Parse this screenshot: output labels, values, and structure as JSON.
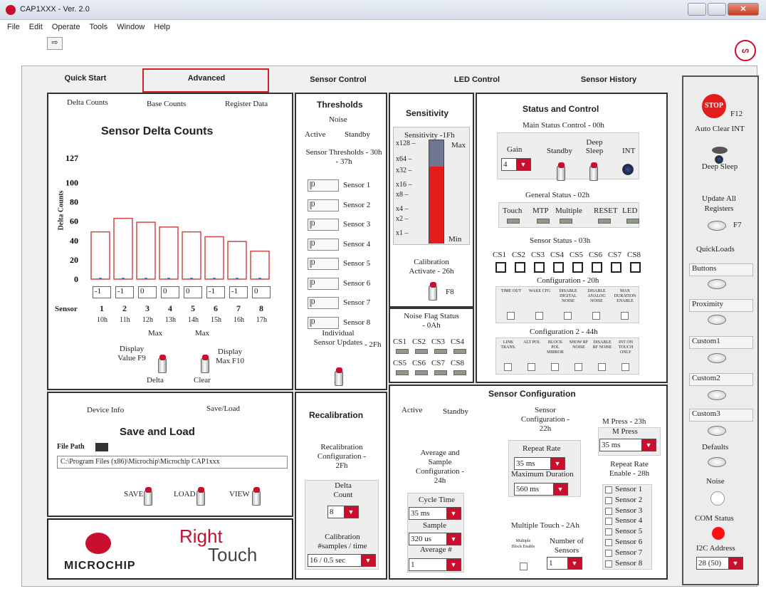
{
  "window": {
    "title": "CAP1XXX - Ver. 2.0"
  },
  "menu": [
    "File",
    "Edit",
    "Operate",
    "Tools",
    "Window",
    "Help"
  ],
  "tabs": [
    "Quick Start",
    "Advanced",
    "Sensor Control",
    "LED Control",
    "Sensor History"
  ],
  "delta": {
    "subtabs": [
      "Delta Counts",
      "Base Counts",
      "Register Data"
    ],
    "title": "Sensor Delta Counts",
    "ylabel": "Delta Counts",
    "sensor_label": "Sensor",
    "display_value": "Display Value F9",
    "delta_label": "Delta",
    "max_label": "Max",
    "max_label2": "Max",
    "display_max": "Display Max F10",
    "clear_label": "Clear"
  },
  "chart_data": {
    "type": "bar",
    "categories": [
      "1",
      "2",
      "3",
      "4",
      "5",
      "6",
      "7",
      "8"
    ],
    "sublabels": [
      "10h",
      "11h",
      "12h",
      "13h",
      "14h",
      "15h",
      "16h",
      "17h"
    ],
    "values": [
      49,
      63,
      59,
      54,
      49,
      44,
      39,
      29
    ],
    "readouts": [
      "-1",
      "-1",
      "0",
      "0",
      "0",
      "-1",
      "-1",
      "0"
    ],
    "yticks": [
      "0",
      "20",
      "40",
      "60",
      "80",
      "100",
      "127"
    ],
    "ylabel": "Delta Counts",
    "ylim": [
      0,
      127
    ]
  },
  "thresholds": {
    "title": "Thresholds",
    "noise": "Noise",
    "active": "Active",
    "standby": "Standby",
    "sub": "Sensor Thresholds - 30h - 37h",
    "sensors": [
      "Sensor 1",
      "Sensor 2",
      "Sensor 3",
      "Sensor 4",
      "Sensor 5",
      "Sensor 6",
      "Sensor 7",
      "Sensor 8"
    ],
    "values": [
      "0",
      "0",
      "0",
      "0",
      "0",
      "0",
      "0",
      "0"
    ],
    "individual": "Individual Sensor Updates",
    "reg": "- 2Fh"
  },
  "sensitivity": {
    "title": "Sensitivity",
    "sub": "Sensitivity -1Fh",
    "scale": [
      "x128",
      "x64",
      "x32",
      "x16",
      "x8",
      "x4",
      "x2",
      "x1"
    ],
    "max": "Max",
    "min": "Min",
    "level": 0.75,
    "calibration": "Calibration Activate - 26h",
    "f8": "F8"
  },
  "noise": {
    "title": "Noise Flag Status - 0Ah",
    "row1": [
      "CS1",
      "CS2",
      "CS3",
      "CS4"
    ],
    "row2": [
      "CS5",
      "CS6",
      "CS7",
      "CS8"
    ]
  },
  "status": {
    "title": "Status and Control",
    "main": "Main Status Control - 00h",
    "gain": "Gain",
    "gain_value": "4",
    "standby": "Standby",
    "deep": "Deep Sleep",
    "int": "INT",
    "general": "General Status - 02h",
    "general_items": [
      "Touch",
      "MTP",
      "Multiple",
      "RESET",
      "LED"
    ],
    "sensor_status": "Sensor Status - 03h",
    "cs": [
      "CS1",
      "CS2",
      "CS3",
      "CS4",
      "CS5",
      "CS6",
      "CS7",
      "CS8"
    ],
    "config": "Configuration - 20h",
    "config_items": [
      "TIME OUT",
      "WAKE CFG",
      "DISABLE DIGITAL NOISE",
      "DISABLE ANALOG NOISE",
      "MAX DURATION ENABLE"
    ],
    "config2": "Configuration 2 - 44h",
    "config2_items": [
      "LINK TRANS.",
      "ALT POL",
      "BLOCK POL MIRROR",
      "SHOW RF NOISE",
      "DISABLE RF NOISE",
      "INT ON TOUCH ONLY"
    ]
  },
  "device": {
    "tabs": [
      "Device Info",
      "Save/Load"
    ],
    "title": "Save and Load",
    "file_path_label": "File Path",
    "file_path": "C:\\Program Files (x86)\\Microchip\\Microchip CAP1xxx",
    "save": "SAVE",
    "load": "LOAD",
    "view": "VIEW"
  },
  "logos": {
    "microchip": "MICROCHIP",
    "right": "Right",
    "touch": "Touch"
  },
  "recal": {
    "title": "Recalibration",
    "config": "Recalibration Configuration - 2Fh",
    "delta": "Delta Count",
    "delta_value": "8",
    "calib": "Calibration #samples / time",
    "calib_value": "16 / 0.5 sec"
  },
  "sensorcfg": {
    "title": "Sensor Configuration",
    "tabs": [
      "Active",
      "Standby"
    ],
    "avg": "Average and Sample Configuration - 24h",
    "cycle": "Cycle Time",
    "cycle_value": "35 ms",
    "sample": "Sample",
    "sample_value": "320 us",
    "average": "Average #",
    "average_value": "1",
    "sc": "Sensor Configuration - 22h",
    "repeat": "Repeat Rate",
    "repeat_value": "35 ms",
    "maxdur": "Maximum Duration",
    "maxdur_value": "560 ms",
    "mpress": "M Press - 23h",
    "mpress_label": "M Press",
    "mpress_value": "35 ms",
    "repeat_en": "Repeat Rate Enable - 28h",
    "sensors": [
      "Sensor 1",
      "Sensor 2",
      "Sensor 3",
      "Sensor 4",
      "Sensor 5",
      "Sensor 6",
      "Sensor 7",
      "Sensor 8"
    ],
    "multi": "Multiple Touch - 2Ah",
    "multi_block": "Multiple Block Enable",
    "num": "Number of Sensors",
    "num_value": "1"
  },
  "side": {
    "stop": "STOP",
    "f12": "F12",
    "auto_clear": "Auto Clear INT",
    "deep": "Deep Sleep",
    "update": "Update All Registers",
    "f7": "F7",
    "quickloads": "QuickLoads",
    "loads": [
      "Buttons",
      "Proximity",
      "Custom1",
      "Custom2",
      "Custom3"
    ],
    "defaults": "Defaults",
    "noise": "Noise",
    "com": "COM Status",
    "i2c": "I2C Address",
    "i2c_value": "28 (50)"
  },
  "colors": {
    "accent": "#c8102e",
    "frame": "#333333"
  }
}
